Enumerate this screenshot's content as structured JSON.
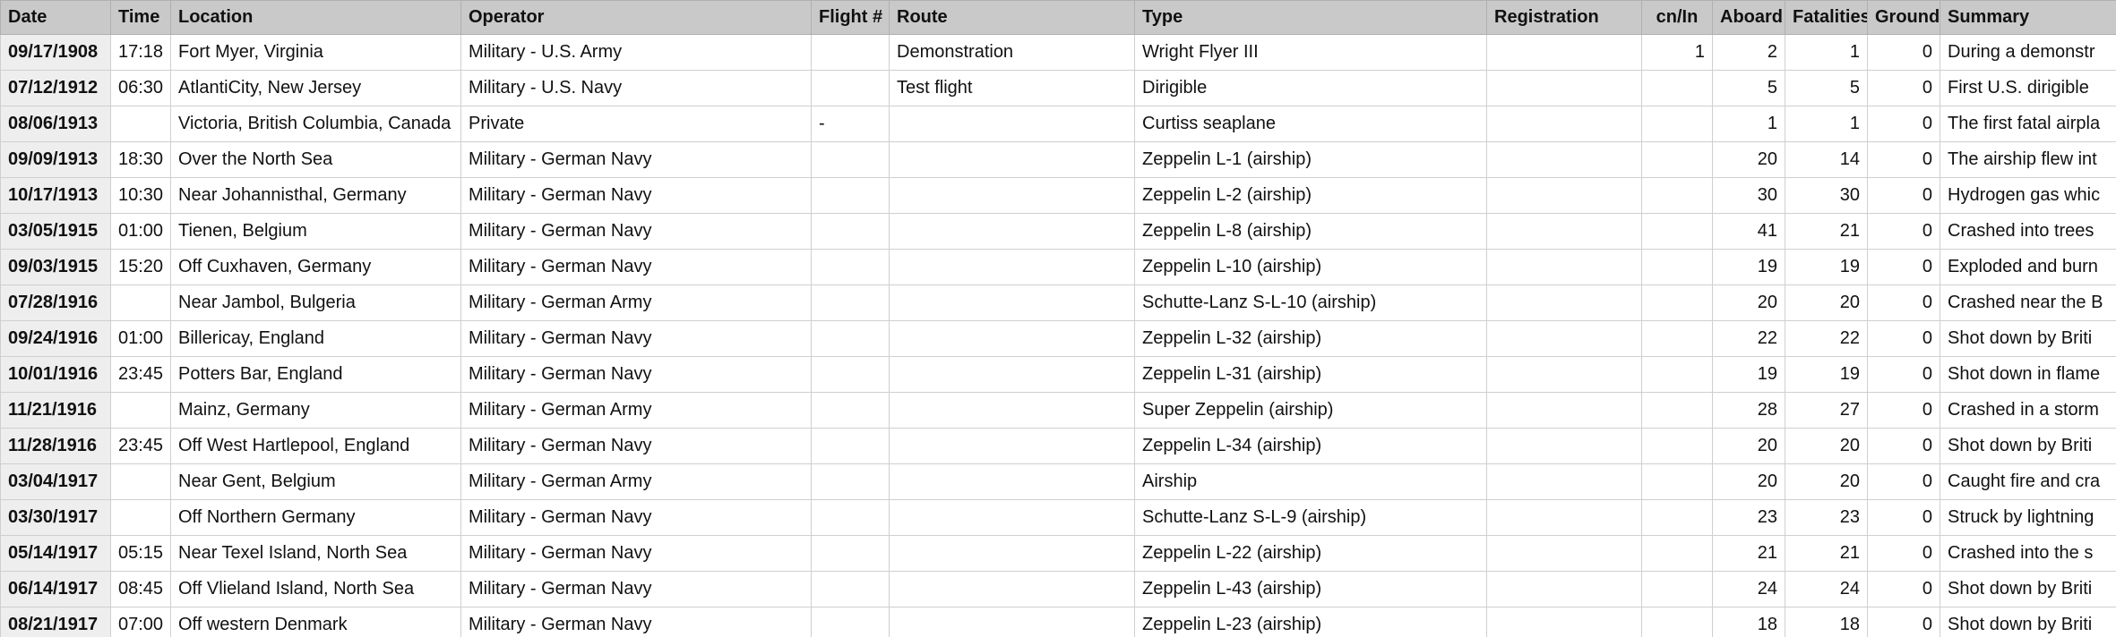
{
  "columns": [
    "Date",
    "Time",
    "Location",
    "Operator",
    "Flight #",
    "Route",
    "Type",
    "Registration",
    "cn/In",
    "Aboard",
    "Fatalities",
    "Ground",
    "Summary"
  ],
  "rows": [
    [
      "09/17/1908",
      "17:18",
      "Fort Myer, Virginia",
      "Military - U.S. Army",
      "",
      "Demonstration",
      "Wright Flyer III",
      "",
      "1",
      "2",
      "1",
      "0",
      "During a demonstr"
    ],
    [
      "07/12/1912",
      "06:30",
      "AtlantiCity, New Jersey",
      "Military - U.S. Navy",
      "",
      "Test flight",
      "Dirigible",
      "",
      "",
      "5",
      "5",
      "0",
      "First U.S. dirigible"
    ],
    [
      "08/06/1913",
      "",
      "Victoria, British Columbia, Canada",
      "Private",
      "-",
      "",
      "Curtiss seaplane",
      "",
      "",
      "1",
      "1",
      "0",
      "The first fatal airpla"
    ],
    [
      "09/09/1913",
      "18:30",
      "Over the North Sea",
      "Military - German Navy",
      "",
      "",
      "Zeppelin L-1 (airship)",
      "",
      "",
      "20",
      "14",
      "0",
      "The airship flew int"
    ],
    [
      "10/17/1913",
      "10:30",
      "Near Johannisthal, Germany",
      "Military - German Navy",
      "",
      "",
      "Zeppelin L-2 (airship)",
      "",
      "",
      "30",
      "30",
      "0",
      "Hydrogen gas whic"
    ],
    [
      "03/05/1915",
      "01:00",
      "Tienen, Belgium",
      "Military - German Navy",
      "",
      "",
      "Zeppelin L-8 (airship)",
      "",
      "",
      "41",
      "21",
      "0",
      "Crashed into trees"
    ],
    [
      "09/03/1915",
      "15:20",
      "Off Cuxhaven, Germany",
      "Military - German Navy",
      "",
      "",
      "Zeppelin L-10 (airship)",
      "",
      "",
      "19",
      "19",
      "0",
      "Exploded and burn"
    ],
    [
      "07/28/1916",
      "",
      "Near Jambol, Bulgeria",
      "Military - German Army",
      "",
      "",
      "Schutte-Lanz S-L-10 (airship)",
      "",
      "",
      "20",
      "20",
      "0",
      "Crashed near the B"
    ],
    [
      "09/24/1916",
      "01:00",
      "Billericay, England",
      "Military - German Navy",
      "",
      "",
      "Zeppelin L-32 (airship)",
      "",
      "",
      "22",
      "22",
      "0",
      "Shot down by Briti"
    ],
    [
      "10/01/1916",
      "23:45",
      "Potters Bar, England",
      "Military - German Navy",
      "",
      "",
      "Zeppelin L-31 (airship)",
      "",
      "",
      "19",
      "19",
      "0",
      "Shot down in flame"
    ],
    [
      "11/21/1916",
      "",
      "Mainz, Germany",
      "Military - German Army",
      "",
      "",
      "Super Zeppelin (airship)",
      "",
      "",
      "28",
      "27",
      "0",
      "Crashed in a storm"
    ],
    [
      "11/28/1916",
      "23:45",
      "Off West Hartlepool, England",
      "Military - German Navy",
      "",
      "",
      "Zeppelin L-34 (airship)",
      "",
      "",
      "20",
      "20",
      "0",
      "Shot down by Briti"
    ],
    [
      "03/04/1917",
      "",
      "Near Gent, Belgium",
      "Military - German Army",
      "",
      "",
      "Airship",
      "",
      "",
      "20",
      "20",
      "0",
      "Caught fire and cra"
    ],
    [
      "03/30/1917",
      "",
      "Off Northern Germany",
      "Military - German Navy",
      "",
      "",
      "Schutte-Lanz S-L-9 (airship)",
      "",
      "",
      "23",
      "23",
      "0",
      "Struck by lightning"
    ],
    [
      "05/14/1917",
      "05:15",
      "Near Texel Island, North Sea",
      "Military - German Navy",
      "",
      "",
      "Zeppelin L-22 (airship)",
      "",
      "",
      "21",
      "21",
      "0",
      "Crashed into the s"
    ],
    [
      "06/14/1917",
      "08:45",
      "Off Vlieland Island, North Sea",
      "Military - German Navy",
      "",
      "",
      "Zeppelin L-43 (airship)",
      "",
      "",
      "24",
      "24",
      "0",
      "Shot down by Briti"
    ],
    [
      "08/21/1917",
      "07:00",
      "Off western Denmark",
      "Military - German Navy",
      "",
      "",
      "Zeppelin L-23 (airship)",
      "",
      "",
      "18",
      "18",
      "0",
      "Shot down by Briti"
    ]
  ]
}
